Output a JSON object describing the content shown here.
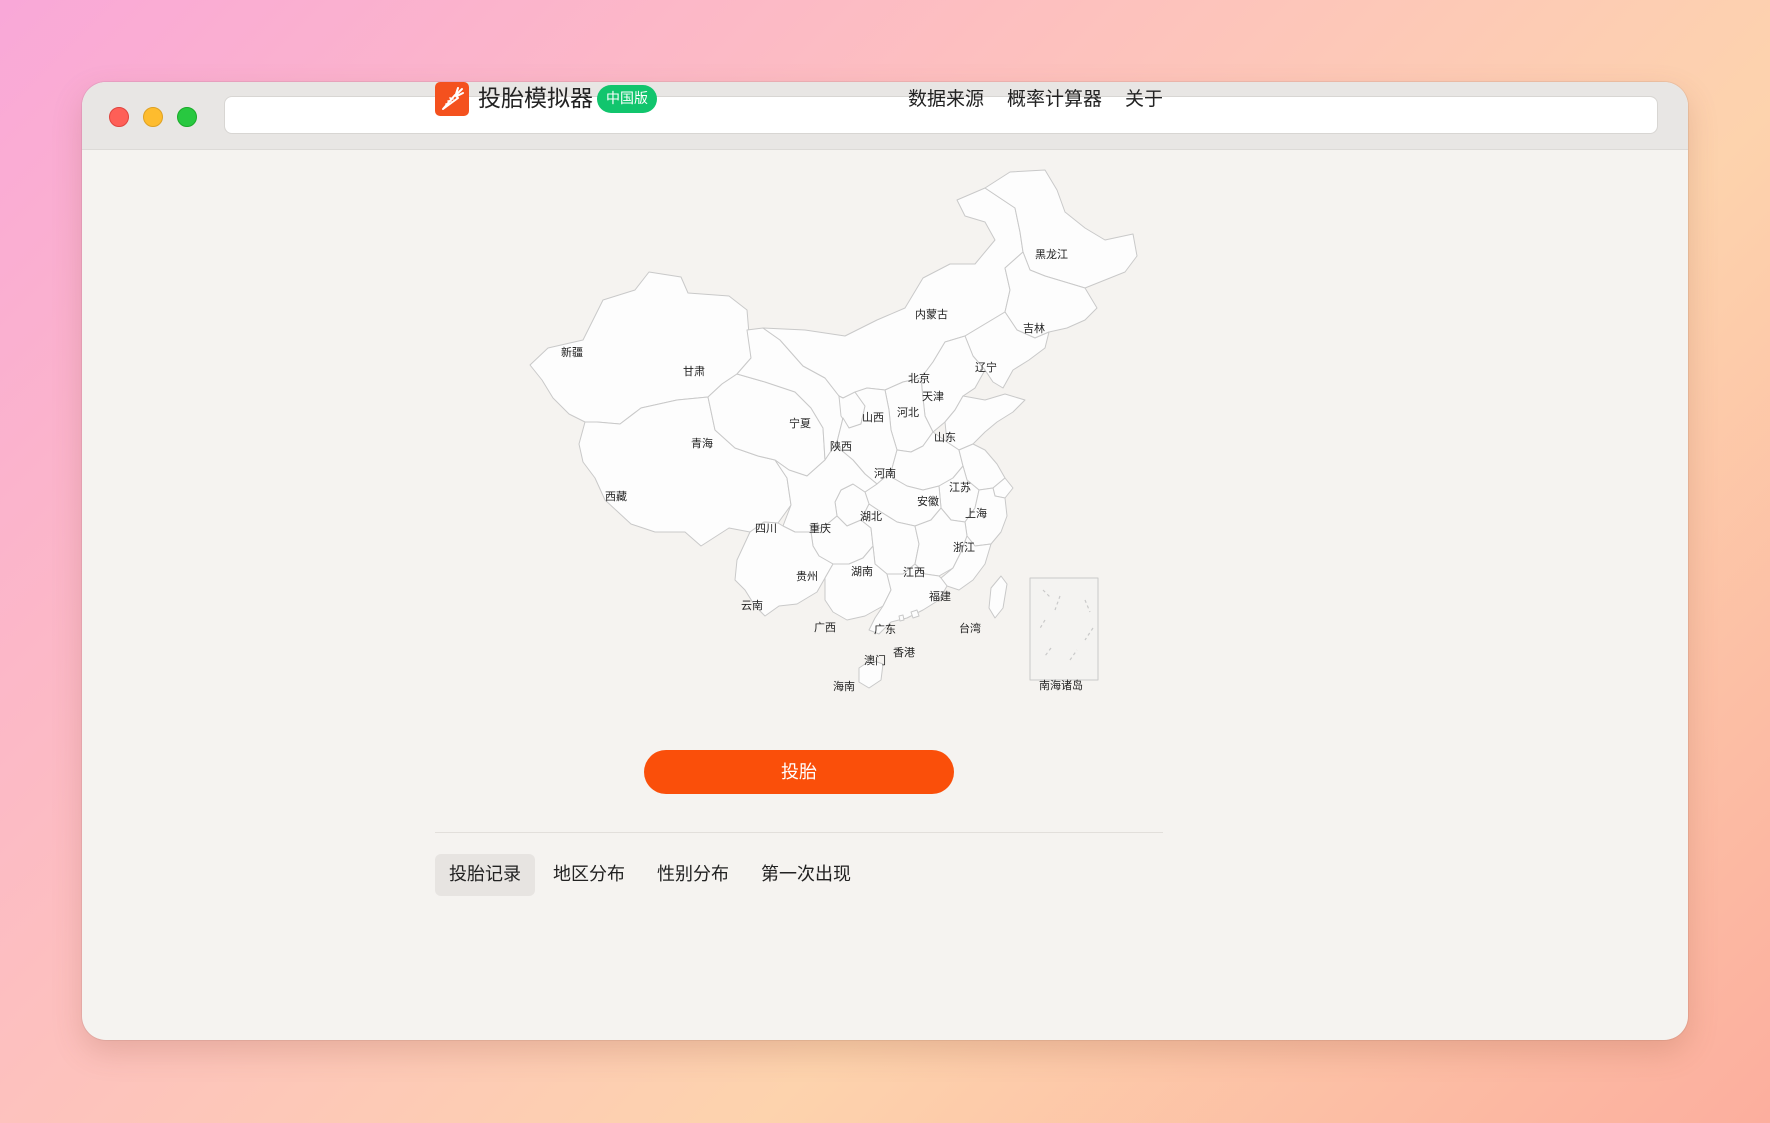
{
  "browser": {
    "url": ""
  },
  "header": {
    "brand_name": "投胎模拟器",
    "badge": "中国版",
    "nav": [
      {
        "label": "数据来源"
      },
      {
        "label": "概率计算器"
      },
      {
        "label": "关于"
      }
    ]
  },
  "map": {
    "provinces": {
      "xinjiang": "新疆",
      "xizang": "西藏",
      "qinghai": "青海",
      "gansu": "甘肃",
      "neimenggu": "内蒙古",
      "heilongjiang": "黑龙江",
      "jilin": "吉林",
      "liaoning": "辽宁",
      "beijing": "北京",
      "tianjin": "天津",
      "hebei": "河北",
      "shanxi": "山西",
      "shandong": "山东",
      "ningxia": "宁夏",
      "shaanxi": "陕西",
      "henan": "河南",
      "jiangsu": "江苏",
      "anhui": "安徽",
      "shanghai": "上海",
      "hubei": "湖北",
      "sichuan": "四川",
      "chongqing": "重庆",
      "zhejiang": "浙江",
      "guizhou": "贵州",
      "hunan": "湖南",
      "jiangxi": "江西",
      "fujian": "福建",
      "yunnan": "云南",
      "guangxi": "广西",
      "guangdong": "广东",
      "taiwan": "台湾",
      "xianggang": "香港",
      "aomen": "澳门",
      "hainan": "海南",
      "nanhai": "南海诸岛"
    }
  },
  "action": {
    "label": "投胎"
  },
  "tabs": [
    {
      "label": "投胎记录",
      "active": true
    },
    {
      "label": "地区分布",
      "active": false
    },
    {
      "label": "性别分布",
      "active": false
    },
    {
      "label": "第一次出现",
      "active": false
    }
  ],
  "colors": {
    "accent": "#fa4f0a",
    "badge": "#11c56d",
    "logo": "#f4511e",
    "map_fill": "#fdfdfd",
    "map_stroke": "#c9c9c9"
  }
}
